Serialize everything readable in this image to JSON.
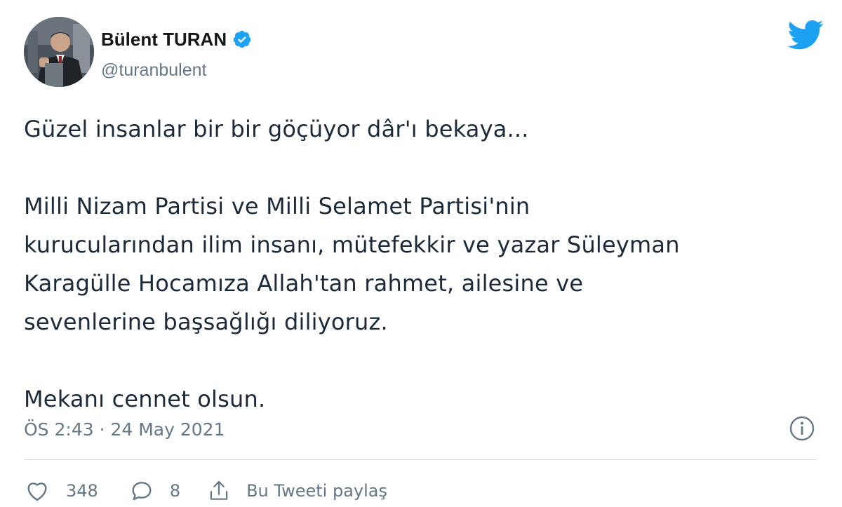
{
  "author": {
    "name": "Bülent TURAN",
    "handle": "@turanbulent",
    "verified": true
  },
  "tweet": {
    "paragraphs": [
      "Güzel insanlar bir bir göçüyor dâr'ı bekaya...",
      "Milli Nizam Partisi ve Milli Selamet Partisi'nin",
      "kurucularından ilim insanı, mütefekkir ve yazar Süleyman",
      "Karagülle Hocamıza Allah'tan rahmet, ailesine ve",
      "sevenlerine başsağlığı diliyoruz.",
      "Mekanı cennet olsun."
    ],
    "timestamp": "ÖS 2:43 · 24 May 2021"
  },
  "actions": {
    "like_count": "348",
    "reply_count": "8",
    "share_label": "Bu Tweeti paylaş"
  },
  "colors": {
    "twitter_blue": "#1da1f2",
    "verified_blue": "#1da1f2",
    "secondary_text": "#657786"
  },
  "icons": {
    "brand": "twitter-bird-icon",
    "verified": "verified-badge-icon",
    "info": "info-icon",
    "like": "heart-icon",
    "reply": "reply-bubble-icon",
    "share": "share-icon"
  }
}
